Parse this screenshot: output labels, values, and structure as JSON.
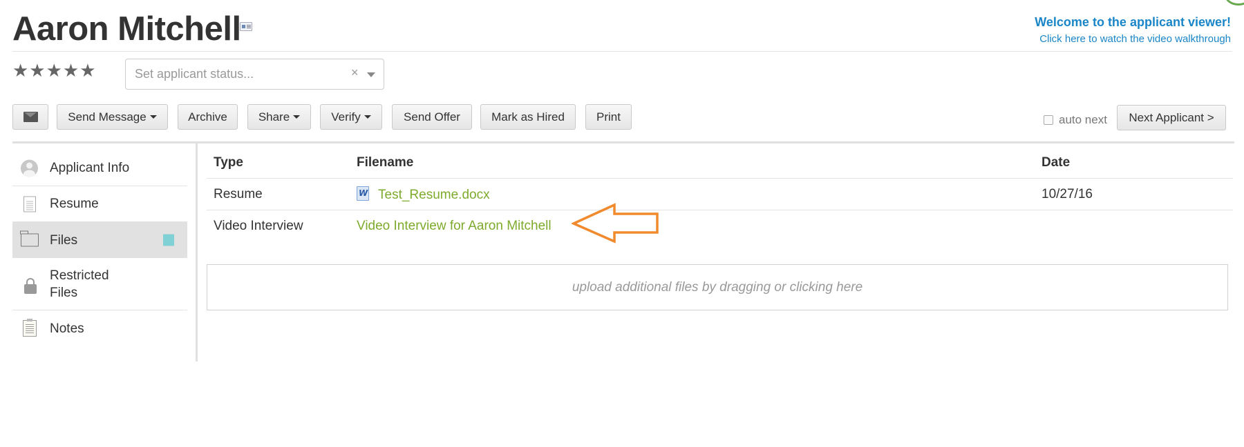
{
  "applicant": {
    "name": "Aaron Mitchell"
  },
  "welcome": {
    "title": "Welcome to the applicant viewer!",
    "link": "Click here to watch the video walkthrough"
  },
  "rating": {
    "stars_display": "★★★★★",
    "value": 0,
    "max": 5
  },
  "status_select": {
    "placeholder": "Set applicant status...",
    "clear_glyph": "×"
  },
  "toolbar": {
    "send_message": "Send Message",
    "archive": "Archive",
    "share": "Share",
    "verify": "Verify",
    "send_offer": "Send Offer",
    "mark_as_hired": "Mark as Hired",
    "print": "Print",
    "auto_next": "auto next",
    "auto_next_checked": false,
    "next_applicant": "Next Applicant >"
  },
  "sidebar": {
    "items": [
      {
        "label": "Applicant Info",
        "icon": "person-icon",
        "active": false
      },
      {
        "label": "Resume",
        "icon": "document-icon",
        "active": false
      },
      {
        "label": "Files",
        "icon": "folder-icon",
        "active": true
      },
      {
        "label": "Restricted Files",
        "label_line1": "Restricted",
        "label_line2": "Files",
        "icon": "lock-icon",
        "active": false
      },
      {
        "label": "Notes",
        "icon": "notes-icon",
        "active": false
      }
    ],
    "active_indicator_color": "#7fd1d6"
  },
  "files_table": {
    "headers": {
      "type": "Type",
      "filename": "Filename",
      "date": "Date"
    },
    "rows": [
      {
        "type": "Resume",
        "filename": "Test_Resume.docx",
        "file_icon": "word-doc-icon",
        "date": "10/27/16"
      },
      {
        "type": "Video Interview",
        "filename": "Video Interview for Aaron Mitchell",
        "file_icon": "",
        "date": ""
      }
    ]
  },
  "upload": {
    "label": "upload additional files by dragging or clicking here"
  },
  "colors": {
    "link_green": "#7eaa2c",
    "welcome_blue": "#1a86c8",
    "annotation_arrow": "#f08a2c"
  }
}
